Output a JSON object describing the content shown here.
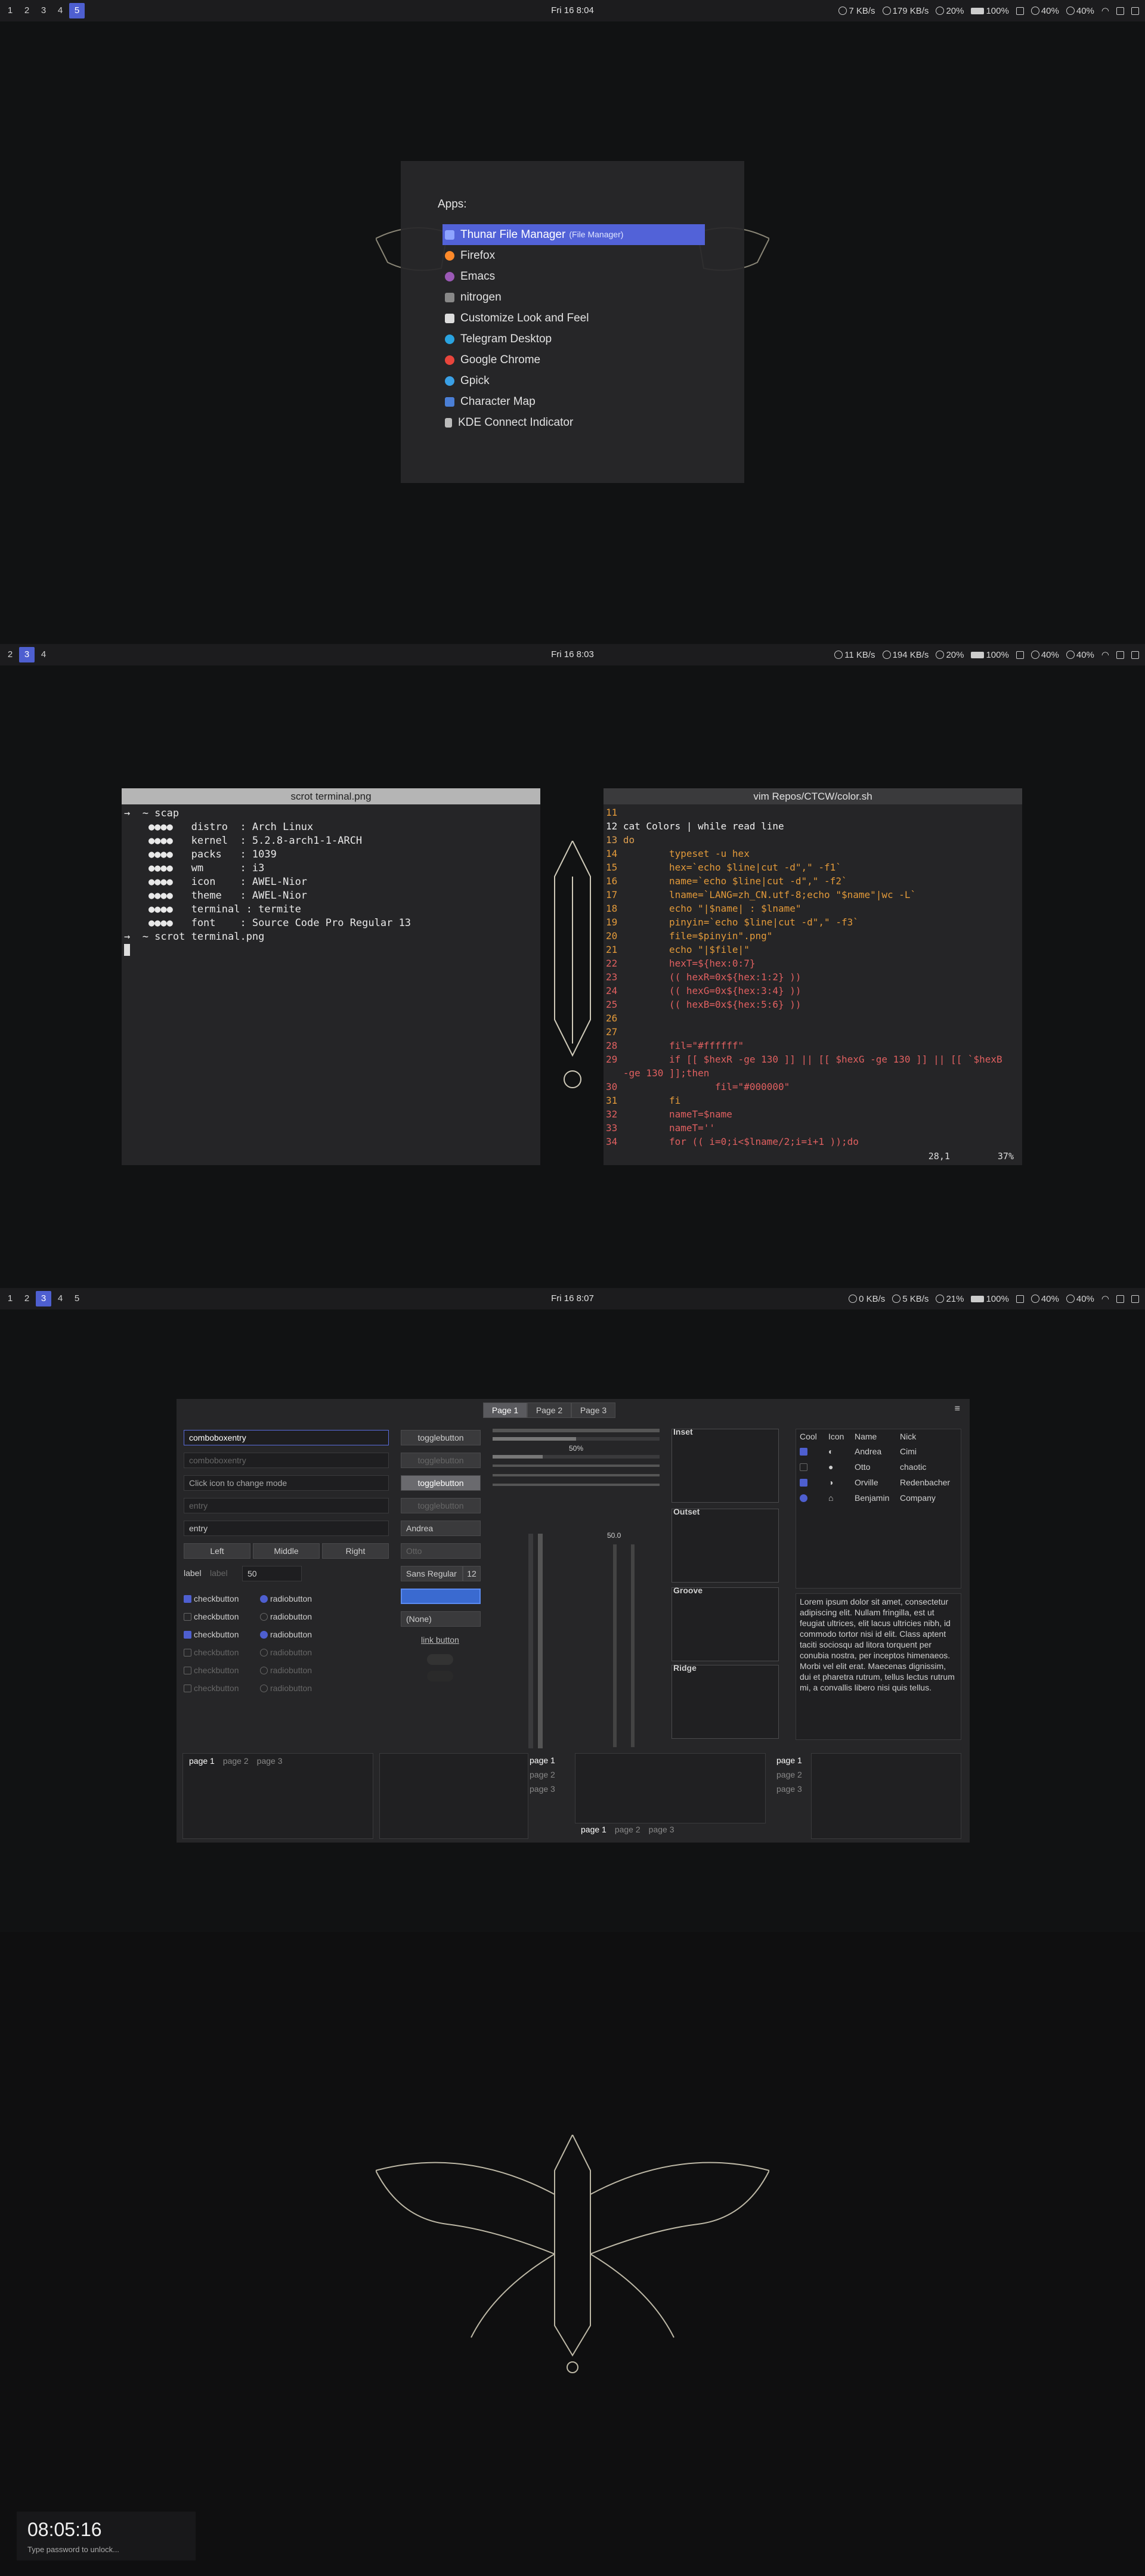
{
  "screen1": {
    "workspaces": [
      "1",
      "2",
      "3",
      "4",
      "5"
    ],
    "active": "5",
    "clock": "Fri 16  8:04",
    "status": {
      "down": "7 KB/s",
      "up": "179 KB/s",
      "cpu": "20%",
      "battery": "100%",
      "brightness": "40%",
      "volume": "40%"
    },
    "launcher": {
      "header": "Apps:",
      "items": [
        {
          "label": "Thunar File Manager",
          "sub": "(File Manager)",
          "color": "#8ea4ff"
        },
        {
          "label": "Firefox",
          "color": "#ff8a2a"
        },
        {
          "label": "Emacs",
          "color": "#9b59b6"
        },
        {
          "label": "nitrogen",
          "color": "#888888"
        },
        {
          "label": "Customize Look and Feel",
          "color": "#dddddd"
        },
        {
          "label": "Telegram Desktop",
          "color": "#2aa3e0"
        },
        {
          "label": "Google Chrome",
          "color": "#e8453c"
        },
        {
          "label": "Gpick",
          "color": "#3aa0e6"
        },
        {
          "label": "Character Map",
          "color": "#4b7fd6"
        },
        {
          "label": "KDE Connect Indicator",
          "color": "#bbbbbb"
        }
      ]
    }
  },
  "screen2": {
    "workspaces": [
      "2",
      "3",
      "4"
    ],
    "active": "3",
    "clock": "Fri 16  8:03",
    "status": {
      "down": "11 KB/s",
      "up": "194 KB/s",
      "cpu": "20%",
      "battery": "100%",
      "brightness": "40%",
      "volume": "40%"
    },
    "term1": {
      "title": "scrot terminal.png",
      "lines": [
        "→  ~ scap",
        "    ●●●●   distro  : Arch Linux",
        "    ●●●●   kernel  : 5.2.8-arch1-1-ARCH",
        "    ●●●●   packs   : 1039",
        "    ●●●●   wm      : i3",
        "    ●●●●   icon    : AWEL-Nior",
        "    ●●●●   theme   : AWEL-Nior",
        "    ●●●●   terminal : termite",
        "    ●●●●   font    : Source Code Pro Regular 13",
        "→  ~ scrot terminal.png"
      ]
    },
    "term2": {
      "title": "vim Repos/CTCW/color.sh",
      "lines": [
        "11",
        "12 cat Colors | while read line",
        "13 do",
        "14         typeset -u hex",
        "15         hex=`echo $line|cut -d\",\" -f1`",
        "16         name=`echo $line|cut -d\",\" -f2`",
        "17         lname=`LANG=zh_CN.utf-8;echo \"$name\"|wc -L`",
        "18         echo \"|$name| : $lname\"",
        "19         pinyin=`echo $line|cut -d\",\" -f3`",
        "20         file=$pinyin\".png\"",
        "21         echo \"|$file|\"",
        "22         hexT=${hex:0:7}",
        "23         (( hexR=0x${hex:1:2} ))",
        "24         (( hexG=0x${hex:3:4} ))",
        "25         (( hexB=0x${hex:5:6} ))",
        "26",
        "27",
        "28         fil=\"#ffffff\"",
        "29         if [[ $hexR -ge 130 ]] || [[ $hexG -ge 130 ]] || [[ `$hexB",
        "   -ge 130 ]];then",
        "30                 fil=\"#000000\"",
        "31         fi",
        "32         nameT=$name",
        "33         nameT=''",
        "34         for (( i=0;i<$lname/2;i=i+1 ));do"
      ],
      "pos": "28,1",
      "pct": "37%"
    }
  },
  "screen3": {
    "workspaces": [
      "1",
      "2",
      "3",
      "4",
      "5"
    ],
    "active": "3",
    "clock": "Fri 16  8:07",
    "status": {
      "down": "0 KB/s",
      "up": "5 KB/s",
      "cpu": "21%",
      "battery": "100%",
      "brightness": "40%",
      "volume": "40%"
    },
    "gtk": {
      "tabs": [
        "Page 1",
        "Page 2",
        "Page 3"
      ],
      "combo1": "comboboxentry",
      "combo2": "comboboxentry",
      "mode": "Click icon to change mode",
      "entry1": "entry",
      "entry2": "entry",
      "aligns": [
        "Left",
        "Middle",
        "Right"
      ],
      "label1": "label",
      "label2": "label",
      "spin": "50",
      "checks": [
        "checkbutton",
        "checkbutton",
        "checkbutton",
        "checkbutton",
        "checkbutton",
        "checkbutton"
      ],
      "radios": [
        "radiobutton",
        "radiobutton",
        "radiobutton",
        "radiobutton",
        "radiobutton",
        "radiobutton"
      ],
      "toggles": [
        "togglebutton",
        "togglebutton",
        "togglebutton",
        "togglebutton"
      ],
      "combo_a": "Andrea",
      "combo_b": "Otto",
      "font": "Sans Regular",
      "fontsize": "12",
      "file": "(None)",
      "link": "link button",
      "scale1": "50%",
      "scale2": "50.0",
      "frames": [
        "Inset",
        "Outset",
        "Groove",
        "Ridge"
      ],
      "tree_head": [
        "Cool",
        "Icon",
        "Name",
        "Nick"
      ],
      "tree_rows": [
        [
          "Andrea",
          "Cimi"
        ],
        [
          "Otto",
          "chaotic"
        ],
        [
          "Orville",
          "Redenbacher"
        ],
        [
          "Benjamin",
          "Company"
        ]
      ],
      "lorem": "Lorem ipsum dolor sit amet, consectetur adipiscing elit. Nullam fringilla, est ut feugiat ultrices, elit lacus ultricies nibh, id commodo tortor nisi id elit. Class aptent taciti sociosqu ad litora torquent per conubia nostra, per inceptos himenaeos. Morbi vel elit erat. Maecenas dignissim, dui et pharetra rutrum, tellus lectus rutrum mi, a convallis libero nisi quis tellus.",
      "nb_tabs": [
        "page 1",
        "page 2",
        "page 3"
      ]
    }
  },
  "lockscreen": {
    "time": "08:05:16",
    "hint": "Type password to unlock..."
  }
}
